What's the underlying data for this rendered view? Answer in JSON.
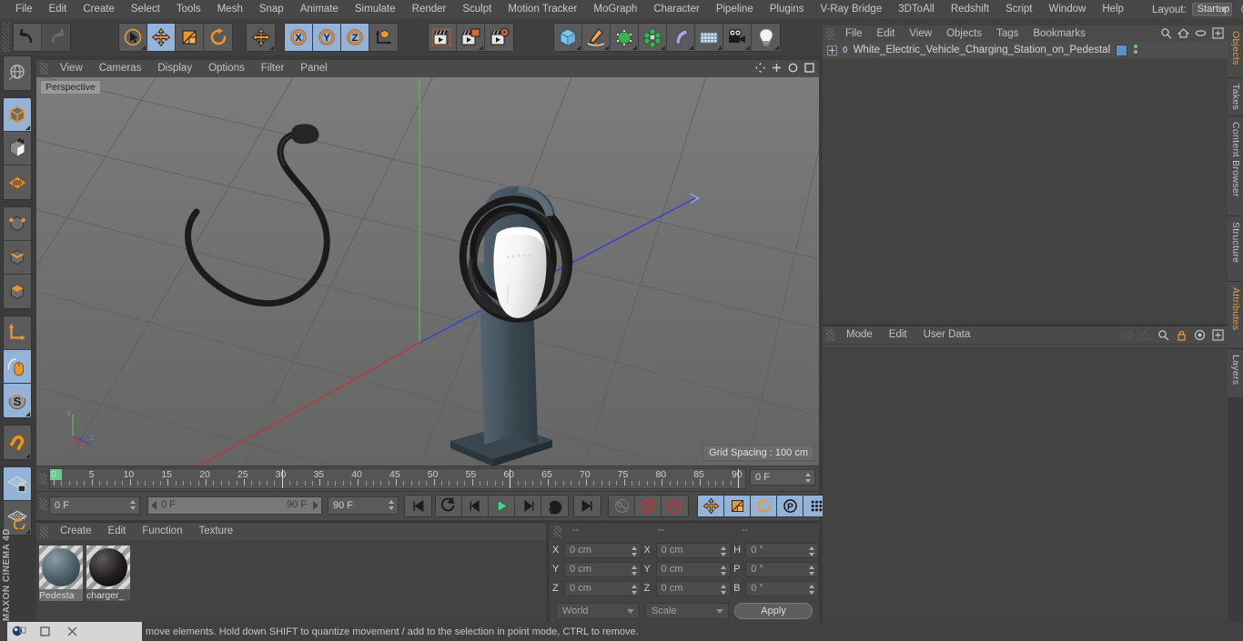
{
  "menu": {
    "items": [
      "File",
      "Edit",
      "Create",
      "Select",
      "Tools",
      "Mesh",
      "Snap",
      "Animate",
      "Simulate",
      "Render",
      "Sculpt",
      "Motion Tracker",
      "MoGraph",
      "Character",
      "Pipeline",
      "Plugins",
      "V-Ray Bridge",
      "3DToAll",
      "Redshift",
      "Script",
      "Window",
      "Help"
    ],
    "layout_label": "Layout:",
    "layout_value": "Startup",
    "search_icon": "magnifier-icon"
  },
  "toolbar": {
    "groups": [
      {
        "name": "history",
        "buttons": [
          {
            "name": "undo-button",
            "icon": "undo-arrow-icon",
            "state": "normal"
          },
          {
            "name": "redo-button",
            "icon": "redo-arrow-icon",
            "state": "disabled"
          }
        ]
      },
      {
        "name": "selection-transform",
        "buttons": [
          {
            "name": "live-selection-tool",
            "icon": "cursor-circle-icon",
            "state": "normal"
          },
          {
            "name": "move-tool",
            "icon": "move-arrows-icon",
            "state": "selected"
          },
          {
            "name": "scale-tool",
            "icon": "scale-box-icon",
            "state": "normal"
          },
          {
            "name": "rotate-tool",
            "icon": "rotate-arc-icon",
            "state": "normal"
          }
        ]
      },
      {
        "name": "move-secondary",
        "buttons": [
          {
            "name": "move-tool-alt",
            "icon": "move-arrows-icon",
            "state": "normal"
          }
        ]
      },
      {
        "name": "axis-locks",
        "buttons": [
          {
            "name": "lock-x-axis",
            "icon": "x-axis-icon",
            "label": "X",
            "state": "selected"
          },
          {
            "name": "lock-y-axis",
            "icon": "y-axis-icon",
            "label": "Y",
            "state": "selected"
          },
          {
            "name": "lock-z-axis",
            "icon": "z-axis-icon",
            "label": "Z",
            "state": "selected"
          },
          {
            "name": "coordinate-system-toggle",
            "icon": "world-object-axis-icon",
            "state": "normal"
          }
        ]
      },
      {
        "name": "render",
        "buttons": [
          {
            "name": "render-view-button",
            "icon": "clapperboard-icon",
            "state": "normal"
          },
          {
            "name": "render-to-picture-viewer-button",
            "icon": "clapperboard-picture-icon",
            "state": "normal"
          },
          {
            "name": "render-settings-button",
            "icon": "clapperboard-gear-icon",
            "state": "normal"
          }
        ]
      },
      {
        "name": "create",
        "buttons": [
          {
            "name": "add-cube-button",
            "icon": "cube-icon",
            "state": "normal"
          },
          {
            "name": "add-spline-button",
            "icon": "pen-spline-icon",
            "state": "normal"
          },
          {
            "name": "add-generator-button",
            "icon": "green-cube-generator-icon",
            "state": "normal"
          },
          {
            "name": "add-mograph-button",
            "icon": "mograph-cloner-icon",
            "state": "normal"
          },
          {
            "name": "add-deformer-button",
            "icon": "bend-deformer-icon",
            "state": "normal"
          },
          {
            "name": "add-environment-button",
            "icon": "floor-environment-icon",
            "state": "normal"
          },
          {
            "name": "add-camera-button",
            "icon": "camera-icon",
            "state": "normal"
          },
          {
            "name": "add-light-button",
            "icon": "light-bulb-icon",
            "state": "normal"
          }
        ]
      }
    ]
  },
  "leftbar": {
    "groups": [
      {
        "buttons": [
          {
            "name": "undo-view-button",
            "icon": "globe-wire-icon",
            "state": "normal"
          }
        ]
      },
      {
        "buttons": [
          {
            "name": "model-mode-button",
            "icon": "model-cube-icon",
            "state": "selected"
          },
          {
            "name": "texture-mode-button",
            "icon": "texture-checker-cube-icon",
            "state": "normal"
          },
          {
            "name": "workplane-mode-button",
            "icon": "workplane-grid-icon",
            "state": "normal"
          }
        ]
      },
      {
        "buttons": [
          {
            "name": "points-mode-button",
            "icon": "points-cube-icon",
            "state": "normal"
          },
          {
            "name": "edges-mode-button",
            "icon": "edges-cube-icon",
            "state": "normal"
          },
          {
            "name": "polygons-mode-button",
            "icon": "polygons-cube-icon",
            "state": "normal"
          }
        ]
      },
      {
        "buttons": [
          {
            "name": "object-axis-mode-button",
            "icon": "axis-corner-icon",
            "state": "normal"
          },
          {
            "name": "enable-axis-modification-button",
            "icon": "mouse-axis-icon",
            "state": "selected"
          },
          {
            "name": "soft-selection-button",
            "icon": "soft-selection-s-icon",
            "state": "selected"
          }
        ]
      },
      {
        "buttons": [
          {
            "name": "snap-magnet-button",
            "icon": "magnet-icon",
            "state": "normal"
          }
        ]
      },
      {
        "buttons": [
          {
            "name": "lock-workplane-button",
            "icon": "workplane-lock-icon",
            "state": "selected"
          },
          {
            "name": "planar-workplane-button",
            "icon": "workplane-rotate-icon",
            "state": "normal"
          }
        ]
      }
    ],
    "brand": "MAXON CINEMA 4D"
  },
  "viewport": {
    "menu": [
      "View",
      "Cameras",
      "Display",
      "Options",
      "Filter",
      "Panel"
    ],
    "nav_icons": [
      "pan-view-icon",
      "zoom-view-icon",
      "rotate-view-icon",
      "maximize-view-icon"
    ],
    "label": "Perspective",
    "grid_spacing": "Grid Spacing : 100 cm",
    "axis_labels": {
      "x": "X",
      "y": "Y",
      "z": "Z"
    },
    "colors": {
      "background_top": "#7a7a7a",
      "background_bottom": "#686868",
      "grid_line": "#5e5e5e",
      "x_axis": "#b43c3c",
      "y_axis": "#4fb44f",
      "z_axis": "#3c46c8",
      "charger_body": "#f0f0f0",
      "pedestal": "#46545e",
      "cable": "#1c1c1c"
    }
  },
  "timeline": {
    "start": 0,
    "end": 90,
    "major_ticks": [
      0,
      5,
      10,
      15,
      20,
      25,
      30,
      35,
      40,
      45,
      50,
      55,
      60,
      65,
      70,
      75,
      80,
      85,
      90
    ],
    "current_frame": 0,
    "frame_field": "0 F"
  },
  "transport": {
    "current_frame_field": "0 F",
    "range_start": "0 F",
    "range_end": "90 F",
    "end_field": "90 F",
    "buttons": [
      {
        "name": "go-to-start-button",
        "icon": "skip-start-icon",
        "state": "normal"
      },
      {
        "name": "previous-keyframe-button",
        "icon": "prev-keyframe-icon",
        "state": "normal"
      },
      {
        "name": "step-back-button",
        "icon": "step-back-icon",
        "state": "normal"
      },
      {
        "name": "play-button",
        "icon": "play-triangle-icon",
        "state": "normal"
      },
      {
        "name": "step-forward-button",
        "icon": "step-forward-icon",
        "state": "normal"
      },
      {
        "name": "next-keyframe-button",
        "icon": "next-keyframe-icon",
        "state": "normal"
      },
      {
        "name": "go-to-end-button",
        "icon": "skip-end-icon",
        "state": "normal"
      }
    ],
    "record_buttons": [
      {
        "name": "autokeying-button",
        "icon": "key-icon",
        "state": "disabled"
      },
      {
        "name": "record-active-objects-button",
        "icon": "record-circle-icon",
        "state": "normal"
      },
      {
        "name": "keyframe-selection-button",
        "icon": "question-circle-icon",
        "state": "normal"
      }
    ],
    "key_toggles": [
      {
        "name": "position-key-button",
        "icon": "move-arrows-icon",
        "state": "selected"
      },
      {
        "name": "scale-key-button",
        "icon": "scale-box-icon",
        "state": "selected"
      },
      {
        "name": "rotation-key-button",
        "icon": "rotate-arc-icon",
        "state": "selected"
      },
      {
        "name": "parameter-key-button",
        "icon": "p-circle-icon",
        "state": "selected"
      },
      {
        "name": "point-level-animation-button",
        "icon": "dot-grid-icon",
        "state": "selected"
      }
    ],
    "timeline_toggle": {
      "name": "timeline-mode-button",
      "icon": "film-strip-icon",
      "state": "selected"
    }
  },
  "material_manager": {
    "menu": [
      "Create",
      "Edit",
      "Function",
      "Texture"
    ],
    "materials": [
      {
        "name": "Pedesta",
        "color": "#4e6068",
        "selected": true
      },
      {
        "name": "charger_",
        "color": "#221f1e",
        "selected": false
      }
    ]
  },
  "coordinates": {
    "header_dashes": [
      "--",
      "--",
      "--"
    ],
    "rows": [
      {
        "pos_label": "X",
        "pos_value": "0 cm",
        "size_label": "X",
        "size_value": "0 cm",
        "rot_label": "H",
        "rot_value": "0 °"
      },
      {
        "pos_label": "Y",
        "pos_value": "0 cm",
        "size_label": "Y",
        "size_value": "0 cm",
        "rot_label": "P",
        "rot_value": "0 °"
      },
      {
        "pos_label": "Z",
        "pos_value": "0 cm",
        "size_label": "Z",
        "size_value": "0 cm",
        "rot_label": "B",
        "rot_value": "0 °"
      }
    ],
    "system_value": "World",
    "mode_value": "Scale",
    "apply_label": "Apply"
  },
  "object_manager": {
    "menu": [
      "File",
      "Edit",
      "View",
      "Objects",
      "Tags",
      "Bookmarks"
    ],
    "icons": [
      "search-icon",
      "home-icon",
      "ellipse-icon",
      "plus-box-icon"
    ],
    "objects": [
      {
        "name": "White_Electric_Vehicle_Charging_Station_on_Pedestal",
        "level_badge": "0",
        "expandable": true
      }
    ]
  },
  "attribute_manager": {
    "menu": [
      "Mode",
      "Edit",
      "User Data"
    ],
    "icons": [
      "history-back-icon",
      "history-forward-icon",
      "search-icon",
      "lock-icon",
      "target-icon",
      "plus-box-icon"
    ]
  },
  "right_tabs": [
    {
      "label": "Objects",
      "highlight": true
    },
    {
      "label": "Takes",
      "highlight": false
    },
    {
      "label": "Content Browser",
      "highlight": false
    },
    {
      "label": "Structure",
      "highlight": false
    },
    {
      "label": "Attributes",
      "highlight": true
    },
    {
      "label": "Layers",
      "highlight": false
    }
  ],
  "statusbar": {
    "message": "move elements. Hold down SHIFT to quantize movement / add to the selection in point mode, CTRL to remove.",
    "taskbar": {
      "app_icon": "cinema4d-icon",
      "restore_icon": "restore-window-icon",
      "maximize_icon": "maximize-window-icon",
      "close_icon": "close-window-icon"
    }
  }
}
